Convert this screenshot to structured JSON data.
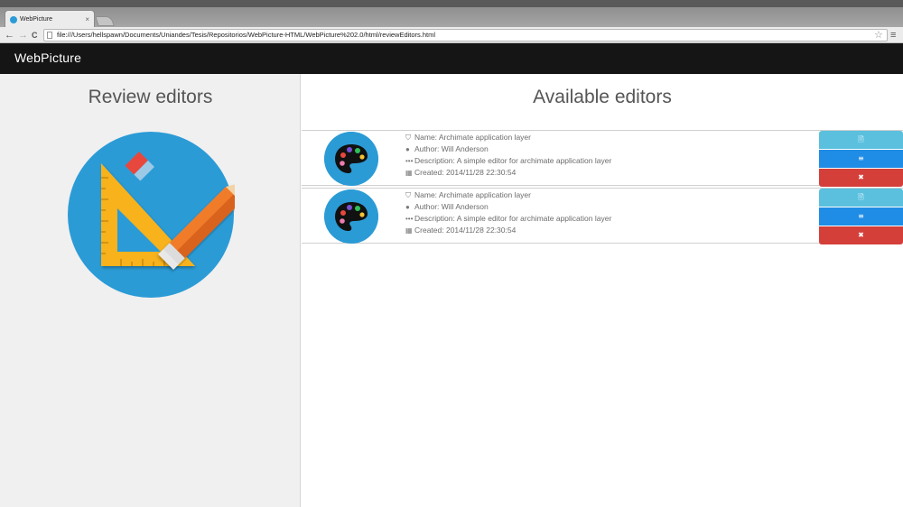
{
  "browser": {
    "tab_title": "WebPicture",
    "tab_close": "×",
    "url": "file:///Users/hellspawn/Documents/Uniandes/Tesis/Repositorios/WebPicture-HTML/WebPicture%202.0/html/reviewEditors.html",
    "back_glyph": "←",
    "forward_glyph": "→",
    "reload_glyph": "C",
    "star_glyph": "☆",
    "menu_glyph": "≡"
  },
  "site": {
    "brand_pre": "Web",
    "brand_pi": "Pi",
    "brand_post": "cture",
    "brand_color": "#2b9bd6"
  },
  "left": {
    "title": "Review editors",
    "hero_icon": "ruler-pencil-icon"
  },
  "right": {
    "title": "Available editors"
  },
  "editors": [
    {
      "name": "Name: Archimate application layer",
      "author": "Author: Will Anderson",
      "description": "Description: A simple editor for archimate application layer",
      "created": "Created: 2014/11/28 22:30:54",
      "view_glyph": "🗎",
      "edit_glyph": "≡",
      "delete_glyph": "✖"
    },
    {
      "name": "Name: Archimate application layer",
      "author": "Author: Will Anderson",
      "description": "Description: A simple editor for archimate application layer",
      "created": "Created: 2014/11/28 22:30:54",
      "view_glyph": "🗎",
      "edit_glyph": "≡",
      "delete_glyph": "✖"
    }
  ],
  "colors": {
    "view_button": "#5bc0de",
    "edit_button": "#1f8ce6",
    "delete_button": "#d43f3a",
    "thumb_bg": "#2b9bd6"
  }
}
